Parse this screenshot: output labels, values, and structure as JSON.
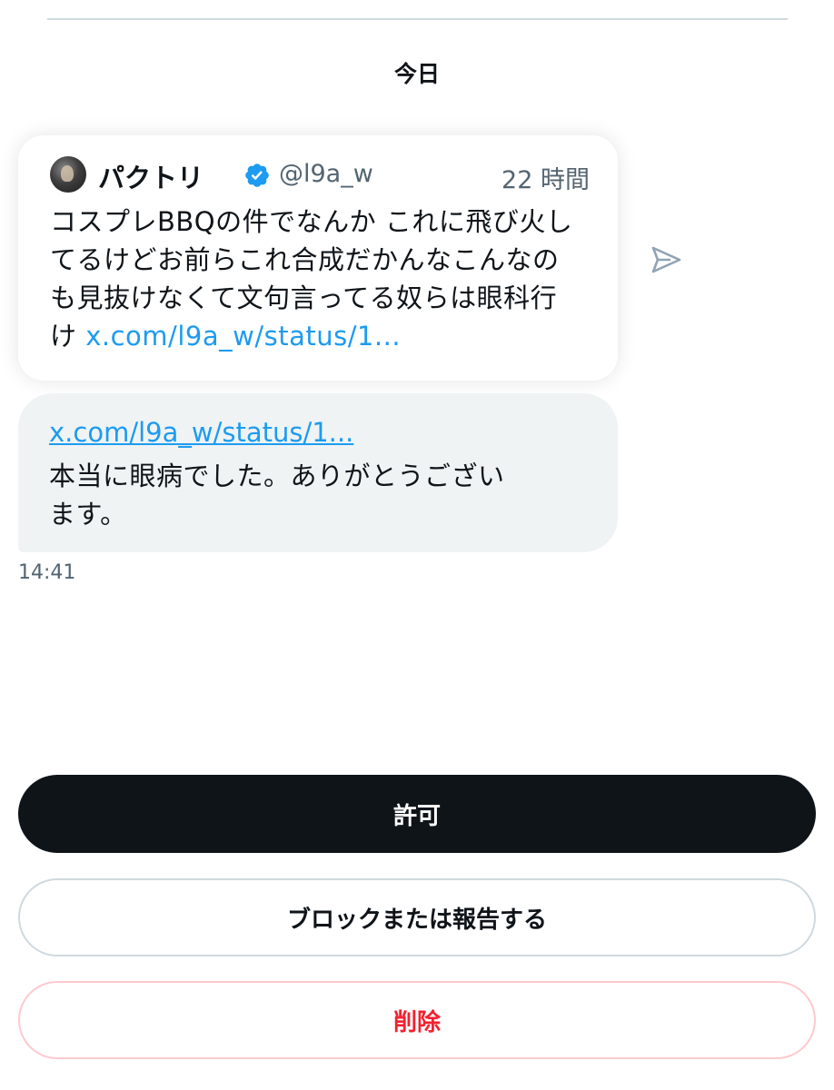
{
  "conversation": {
    "date_label": "今日"
  },
  "quoted_tweet": {
    "display_name": "パクトリ",
    "handle": "@l9a_w",
    "time": "22 時間",
    "body_lines": [
      "コスプレBBQの件でなんか これに飛び火し",
      "てるけどお前らこれ合成だかんなこんなの",
      "も見抜けなくて文句言ってる奴らは眼科行"
    ],
    "body_last_prefix": "け",
    "link": "x.com/l9a_w/status/1..."
  },
  "message": {
    "link": "x.com/l9a_w/status/1...",
    "text_lines": [
      "本当に眼病でした。ありがとうござい",
      "ます。"
    ],
    "time": "14:41"
  },
  "actions": {
    "allow_label": "許可",
    "block_label": "ブロックまたは報告する",
    "delete_label": "削除"
  },
  "colors": {
    "link": "#1d9bf0",
    "verified": "#1d9bf0",
    "danger": "#f4212e",
    "primary_button": "#0f1419",
    "bubble": "#eff3f4"
  },
  "icons": {
    "verified": "verified-badge-icon",
    "share": "share-send-icon"
  }
}
